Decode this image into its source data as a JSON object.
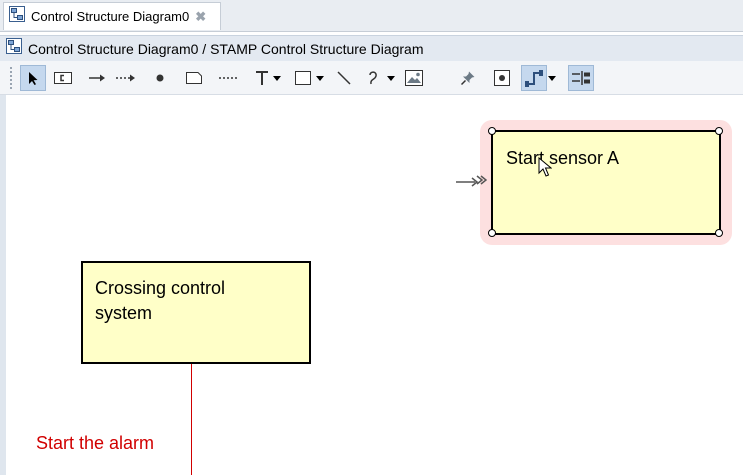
{
  "editor_tab": {
    "label": "Control Structure Diagram0",
    "close_symbol": "✖",
    "icon": "diagram-icon"
  },
  "breadcrumb": {
    "text": "Control Structure Diagram0 / STAMP Control Structure Diagram",
    "icon": "diagram-icon"
  },
  "toolbar": {
    "tools": [
      "select-arrow-icon",
      "controller-icon",
      "control-action-arrow-icon",
      "feedback-dashed-arrow-icon",
      "dot-icon",
      "note-icon",
      "dotted-line-icon",
      "text-icon",
      "rectangle-icon",
      "line-icon",
      "freeform-icon",
      "image-icon",
      "pin-icon",
      "snap-icon",
      "connector-style-icon",
      "align-icon"
    ],
    "selected_tool": "select-arrow-icon"
  },
  "diagram": {
    "controller_block": {
      "label_line1": "Crossing control",
      "label_line2": "system"
    },
    "sensor_block": {
      "label": "Start sensor A",
      "selected": true
    },
    "control_action_label": "Start the alarm",
    "colors": {
      "block_fill": "#ffffc8",
      "control_action": "#d10000",
      "selection_halo": "#fde0e0"
    }
  }
}
